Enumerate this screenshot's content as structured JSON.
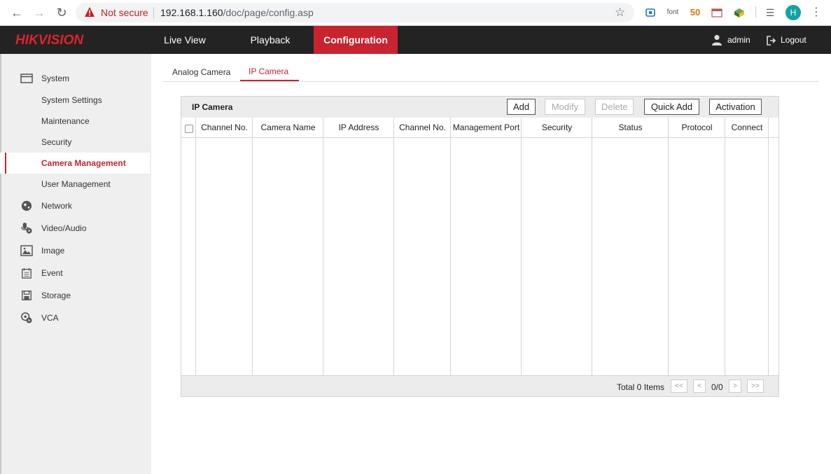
{
  "browser": {
    "security_label": "Not secure",
    "url_host": "192.168.1.160",
    "url_path": "/doc/page/config.asp",
    "extensions": [
      "font",
      "50"
    ],
    "profile_initial": "H"
  },
  "header": {
    "logo": "HIKVISION",
    "tabs": [
      {
        "label": "Live View"
      },
      {
        "label": "Playback"
      },
      {
        "label": "Configuration",
        "active": true
      }
    ],
    "user": "admin",
    "logout": "Logout",
    "accent": "#c8232e"
  },
  "sidebar": {
    "items": [
      {
        "label": "System",
        "icon": "monitor-icon"
      },
      {
        "label": "System Settings"
      },
      {
        "label": "Maintenance"
      },
      {
        "label": "Security"
      },
      {
        "label": "Camera Management",
        "active": true
      },
      {
        "label": "User Management"
      },
      {
        "label": "Network",
        "icon": "globe-icon"
      },
      {
        "label": "Video/Audio",
        "icon": "microphone-icon"
      },
      {
        "label": "Image",
        "icon": "image-icon"
      },
      {
        "label": "Event",
        "icon": "calendar-icon"
      },
      {
        "label": "Storage",
        "icon": "floppy-icon"
      },
      {
        "label": "VCA",
        "icon": "vca-icon"
      }
    ]
  },
  "subtabs": [
    {
      "label": "Analog Camera"
    },
    {
      "label": "IP Camera",
      "active": true
    }
  ],
  "panel": {
    "title": "IP Camera",
    "buttons": {
      "add": "Add",
      "modify": "Modify",
      "delete": "Delete",
      "quick_add": "Quick Add",
      "activation": "Activation"
    },
    "columns": [
      "Channel No.",
      "Camera Name",
      "IP Address",
      "Channel No.",
      "Management Port",
      "Security",
      "Status",
      "Protocol",
      "Connect"
    ],
    "rows": [],
    "footer": {
      "total": "Total 0 Items",
      "first": "<<",
      "prev": "<",
      "page": "0/0",
      "next": ">",
      "last": ">>"
    }
  }
}
